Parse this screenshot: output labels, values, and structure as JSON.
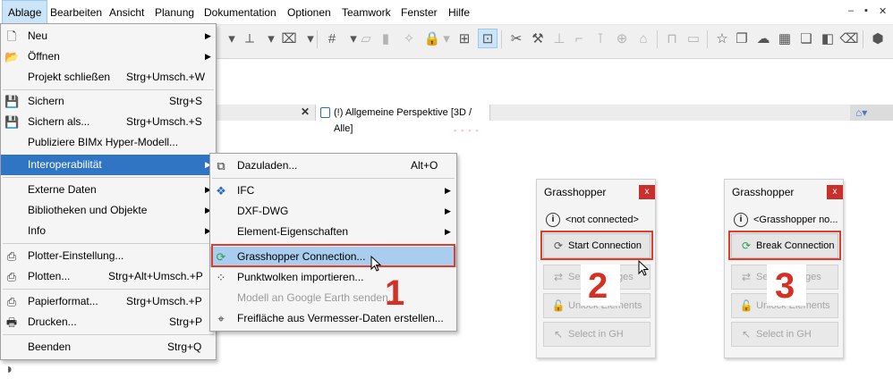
{
  "menubar": {
    "items": [
      "Ablage",
      "Bearbeiten",
      "Ansicht",
      "Planung",
      "Dokumentation",
      "Optionen",
      "Teamwork",
      "Fenster",
      "Hilfe"
    ],
    "minimize": "‒",
    "restore": "▪",
    "close": "✕"
  },
  "tab": {
    "close": "✕",
    "label": "(!) Allgemeine Perspektive [3D / Alle]",
    "dash": "- - - -"
  },
  "ablage_menu": {
    "items": [
      {
        "label": "Neu",
        "shortcut": "",
        "icon": "new-icon",
        "arrow": true
      },
      {
        "label": "Öffnen",
        "shortcut": "",
        "icon": "open-icon",
        "arrow": true
      },
      {
        "label": "Projekt schließen",
        "shortcut": "Strg+Umsch.+W",
        "icon": "",
        "arrow": false
      },
      {
        "label": "Sichern",
        "shortcut": "Strg+S",
        "icon": "save-icon",
        "arrow": false
      },
      {
        "label": "Sichern als...",
        "shortcut": "Strg+Umsch.+S",
        "icon": "save-as-icon",
        "arrow": false
      },
      {
        "label": "Publiziere BIMx Hyper-Modell...",
        "shortcut": "",
        "icon": "",
        "arrow": false
      },
      {
        "label": "Interoperabilität",
        "shortcut": "",
        "icon": "",
        "arrow": true
      },
      {
        "label": "Externe Daten",
        "shortcut": "",
        "icon": "",
        "arrow": true
      },
      {
        "label": "Bibliotheken und Objekte",
        "shortcut": "",
        "icon": "",
        "arrow": true
      },
      {
        "label": "Info",
        "shortcut": "",
        "icon": "",
        "arrow": true
      },
      {
        "label": "Plotter-Einstellung...",
        "shortcut": "",
        "icon": "plotter-setup-icon",
        "arrow": false
      },
      {
        "label": "Plotten...",
        "shortcut": "Strg+Alt+Umsch.+P",
        "icon": "plot-icon",
        "arrow": false
      },
      {
        "label": "Papierformat...",
        "shortcut": "Strg+Umsch.+P",
        "icon": "page-setup-icon",
        "arrow": false
      },
      {
        "label": "Drucken...",
        "shortcut": "Strg+P",
        "icon": "print-icon",
        "arrow": false
      },
      {
        "label": "Beenden",
        "shortcut": "Strg+Q",
        "icon": "",
        "arrow": false
      }
    ]
  },
  "interop_menu": {
    "items": [
      {
        "label": "Dazuladen...",
        "shortcut": "Alt+O",
        "arrow": false,
        "disabled": false
      },
      {
        "label": "IFC",
        "shortcut": "",
        "arrow": true,
        "disabled": false
      },
      {
        "label": "DXF-DWG",
        "shortcut": "",
        "arrow": true,
        "disabled": false
      },
      {
        "label": "Element-Eigenschaften",
        "shortcut": "",
        "arrow": true,
        "disabled": false
      },
      {
        "label": "Grasshopper Connection...",
        "shortcut": "",
        "arrow": false,
        "disabled": false
      },
      {
        "label": "Punktwolken importieren...",
        "shortcut": "",
        "arrow": false,
        "disabled": false
      },
      {
        "label": "Modell an Google Earth senden...",
        "shortcut": "",
        "arrow": false,
        "disabled": true
      },
      {
        "label": "Freifläche aus Vermesser-Daten erstellen...",
        "shortcut": "",
        "arrow": false,
        "disabled": false
      }
    ]
  },
  "step_labels": [
    "1",
    "2",
    "3"
  ],
  "panel_a": {
    "title": "Grasshopper",
    "close": "x",
    "status": "<not connected>",
    "buttons": [
      {
        "label": "Start Connection",
        "disabled": false
      },
      {
        "label": "Send Changes",
        "disabled": true
      },
      {
        "label": "Unlock Elements",
        "disabled": true
      },
      {
        "label": "Select in GH",
        "disabled": true
      }
    ]
  },
  "panel_b": {
    "title": "Grasshopper",
    "close": "x",
    "status": "<Grasshopper no...",
    "buttons": [
      {
        "label": "Break Connection",
        "disabled": false
      },
      {
        "label": "Send Changes",
        "disabled": true
      },
      {
        "label": "Unlock Elements",
        "disabled": true
      },
      {
        "label": "Select in GH",
        "disabled": true
      }
    ]
  },
  "colors": {
    "highlight": "#2f75c4",
    "annotation_red": "#d62f24",
    "close_red": "#c9302c"
  }
}
